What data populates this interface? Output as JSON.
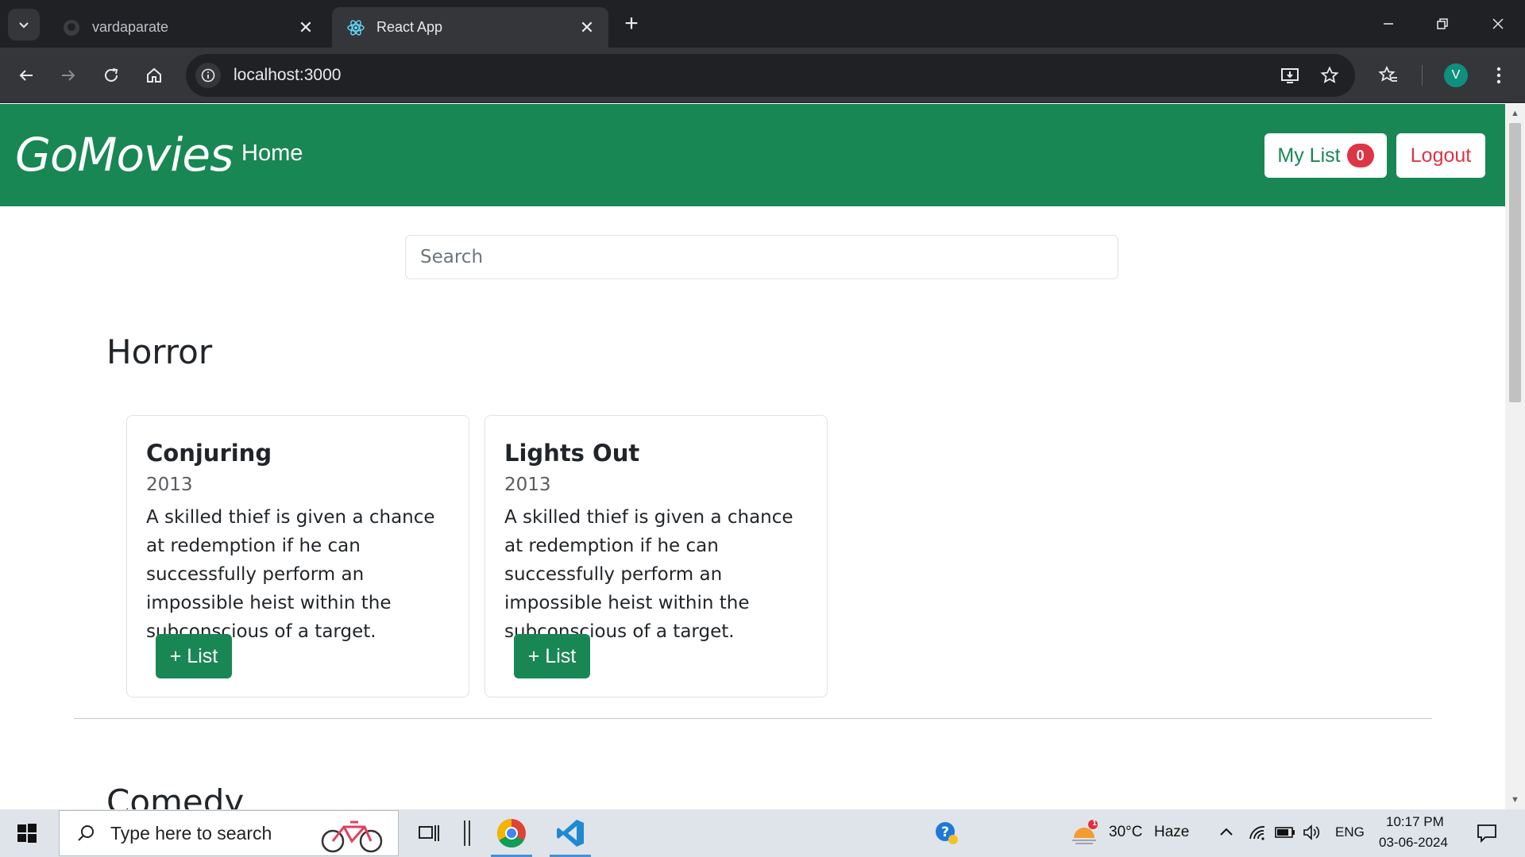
{
  "browser": {
    "tabs": [
      {
        "title": "vardaparate",
        "favicon": "github-icon",
        "active": false
      },
      {
        "title": "React App",
        "favicon": "react-icon",
        "active": true
      }
    ],
    "url": "localhost:3000",
    "profile_initial": "V"
  },
  "navbar": {
    "brand": "GoMovies",
    "home_label": "Home",
    "mylist_label": "My List",
    "mylist_count": "0",
    "logout_label": "Logout"
  },
  "search": {
    "placeholder": "Search",
    "value": ""
  },
  "sections": [
    {
      "title": "Horror",
      "movies": [
        {
          "title": "Conjuring",
          "year": "2013",
          "description": "A skilled thief is given a chance at redemption if he can successfully perform an impossible heist within the subconscious of a target.",
          "button_label": "+ List"
        },
        {
          "title": "Lights Out",
          "year": "2013",
          "description": "A skilled thief is given a chance at redemption if he can successfully perform an impossible heist within the subconscious of a target.",
          "button_label": "+ List"
        }
      ]
    },
    {
      "title": "Comedy",
      "movies": []
    }
  ],
  "taskbar": {
    "search_placeholder": "Type here to search",
    "weather_temp": "30°C",
    "weather_desc": "Haze",
    "weather_badge": "1",
    "language": "ENG",
    "time": "10:17 PM",
    "date": "03-06-2024"
  },
  "colors": {
    "brand_green": "#198754",
    "danger_red": "#dc3545",
    "chrome_dark": "#202124",
    "chrome_toolbar": "#35363a"
  }
}
